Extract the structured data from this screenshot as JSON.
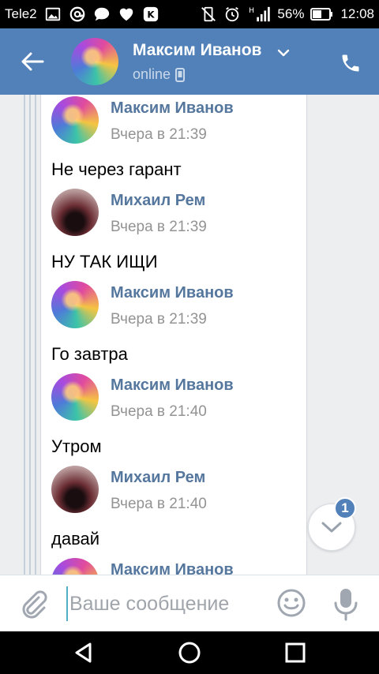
{
  "status_bar": {
    "carrier": "Tele2",
    "battery": "56%",
    "time": "12:08",
    "network_label": "H",
    "left_icons": [
      "image-icon",
      "at-sign-icon",
      "chat-bubble-icon",
      "heart-icon",
      "vk-notification-icon"
    ],
    "right_icons": [
      "vibrate-off-icon",
      "alarm-icon",
      "signal-icon",
      "battery-icon"
    ]
  },
  "header": {
    "name": "Максим Иванов",
    "status": "online",
    "back_icon": "arrow-left-icon",
    "call_icon": "phone-icon",
    "background": "#5181b8"
  },
  "messages": [
    {
      "author": "Максим Иванов",
      "time": "Вчера в 21:39",
      "text": "Не через гарант",
      "avatar": "maxim"
    },
    {
      "author": "Михаил Рем",
      "time": "Вчера в 21:39",
      "text": "НУ ТАК ИЩИ",
      "avatar": "mikhail"
    },
    {
      "author": "Максим Иванов",
      "time": "Вчера в 21:39",
      "text": "Го завтра",
      "avatar": "maxim"
    },
    {
      "author": "Максим Иванов",
      "time": "Вчера в 21:40",
      "text": "Утром",
      "avatar": "maxim"
    },
    {
      "author": "Михаил Рем",
      "time": "Вчера в 21:40",
      "text": "давай",
      "avatar": "mikhail"
    },
    {
      "author": "Максим Иванов",
      "time": "",
      "text": "",
      "avatar": "maxim"
    }
  ],
  "scroll_down": {
    "badge": "1"
  },
  "composer": {
    "placeholder": "Ваше сообщение",
    "value": ""
  },
  "colors": {
    "accent": "#5181b8",
    "author_name": "#55779e",
    "time_text": "#939393"
  }
}
